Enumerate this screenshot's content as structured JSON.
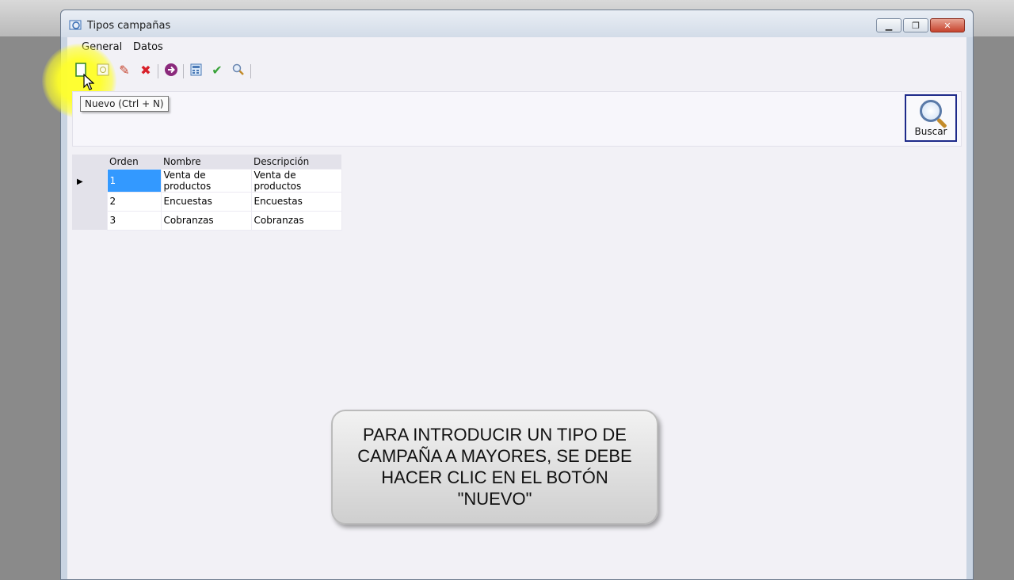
{
  "window": {
    "title": "Tipos campañas"
  },
  "menu": {
    "items": [
      "General",
      "Datos"
    ]
  },
  "toolbar": {
    "buttons": [
      "new-icon",
      "view-icon",
      "edit-icon",
      "delete-icon",
      "navigate-icon",
      "calculator-icon",
      "accept-icon",
      "search-icon"
    ]
  },
  "tooltip": "Nuevo (Ctrl + N)",
  "search_button": {
    "label": "Buscar"
  },
  "grid": {
    "columns": [
      "Orden",
      "Nombre",
      "Descripción"
    ],
    "rows": [
      [
        "1",
        "Venta de productos",
        "Venta de productos"
      ],
      [
        "2",
        "Encuestas",
        "Encuestas"
      ],
      [
        "3",
        "Cobranzas",
        "Cobranzas"
      ]
    ]
  },
  "caption": "PARA INTRODUCIR UN TIPO DE CAMPAÑA A MAYORES, SE DEBE HACER CLIC EN EL BOTÓN \"NUEVO\"",
  "colors": {
    "selection": "#3399ff",
    "highlight": "#ffff28",
    "close": "#c6432d"
  }
}
